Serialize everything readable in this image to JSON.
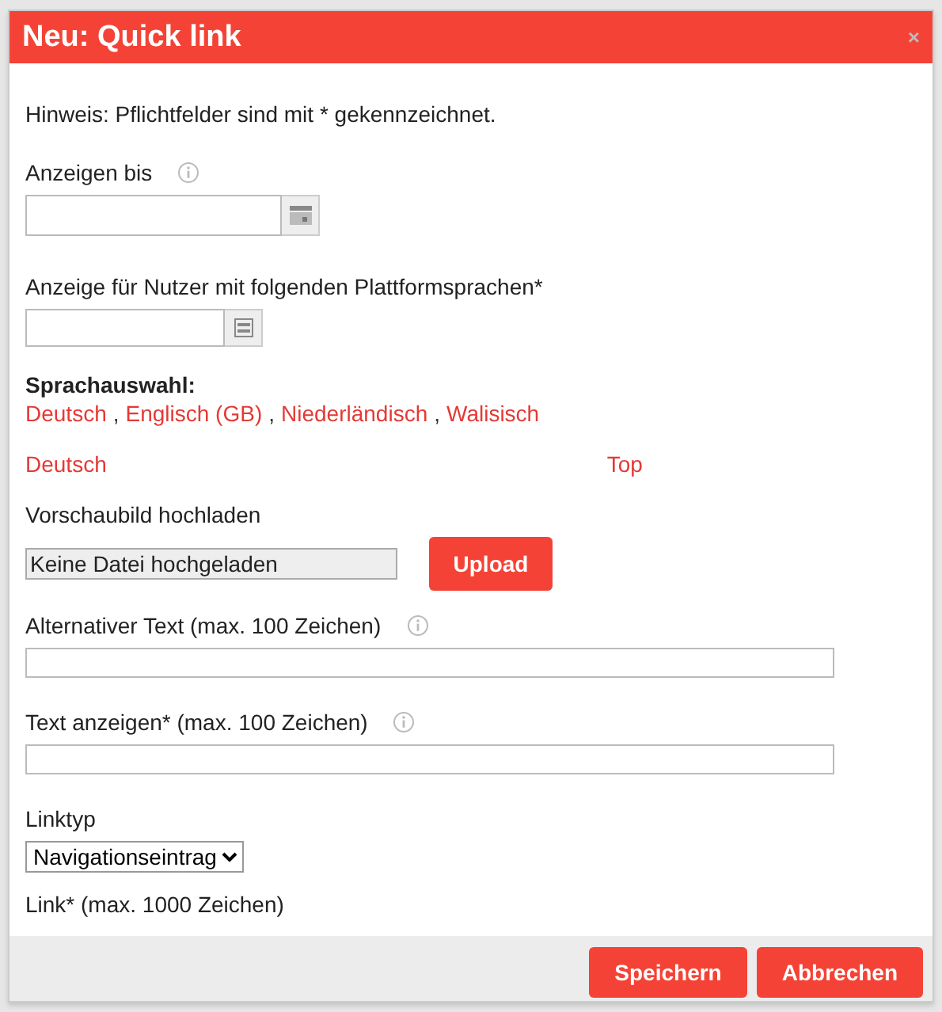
{
  "dialog": {
    "title": "Neu: Quick link",
    "close": "×"
  },
  "hint": "Hinweis: Pflichtfelder sind mit * gekennzeichnet.",
  "display_until": {
    "label": "Anzeigen bis"
  },
  "platform_languages": {
    "label": "Anzeige für Nutzer mit folgenden Plattformsprachen*"
  },
  "language_selection": {
    "label": "Sprachauswahl:",
    "languages": [
      "Deutsch",
      "Englisch (GB)",
      "Niederländisch",
      "Walisisch"
    ],
    "separator": ","
  },
  "current_language": "Deutsch",
  "top_link": "Top",
  "thumbnail": {
    "label": "Vorschaubild hochladen",
    "file": "Keine Datei hochgeladen",
    "button": "Upload"
  },
  "alt_text": {
    "label": "Alternativer Text (max. 100 Zeichen)"
  },
  "display_text": {
    "label": "Text anzeigen* (max. 100 Zeichen)"
  },
  "link_type": {
    "label": "Linktyp",
    "value": "Navigationseintrag"
  },
  "link": {
    "label": "Link* (max. 1000 Zeichen)"
  },
  "buttons": [
    "Speichern",
    "Abbrechen"
  ]
}
